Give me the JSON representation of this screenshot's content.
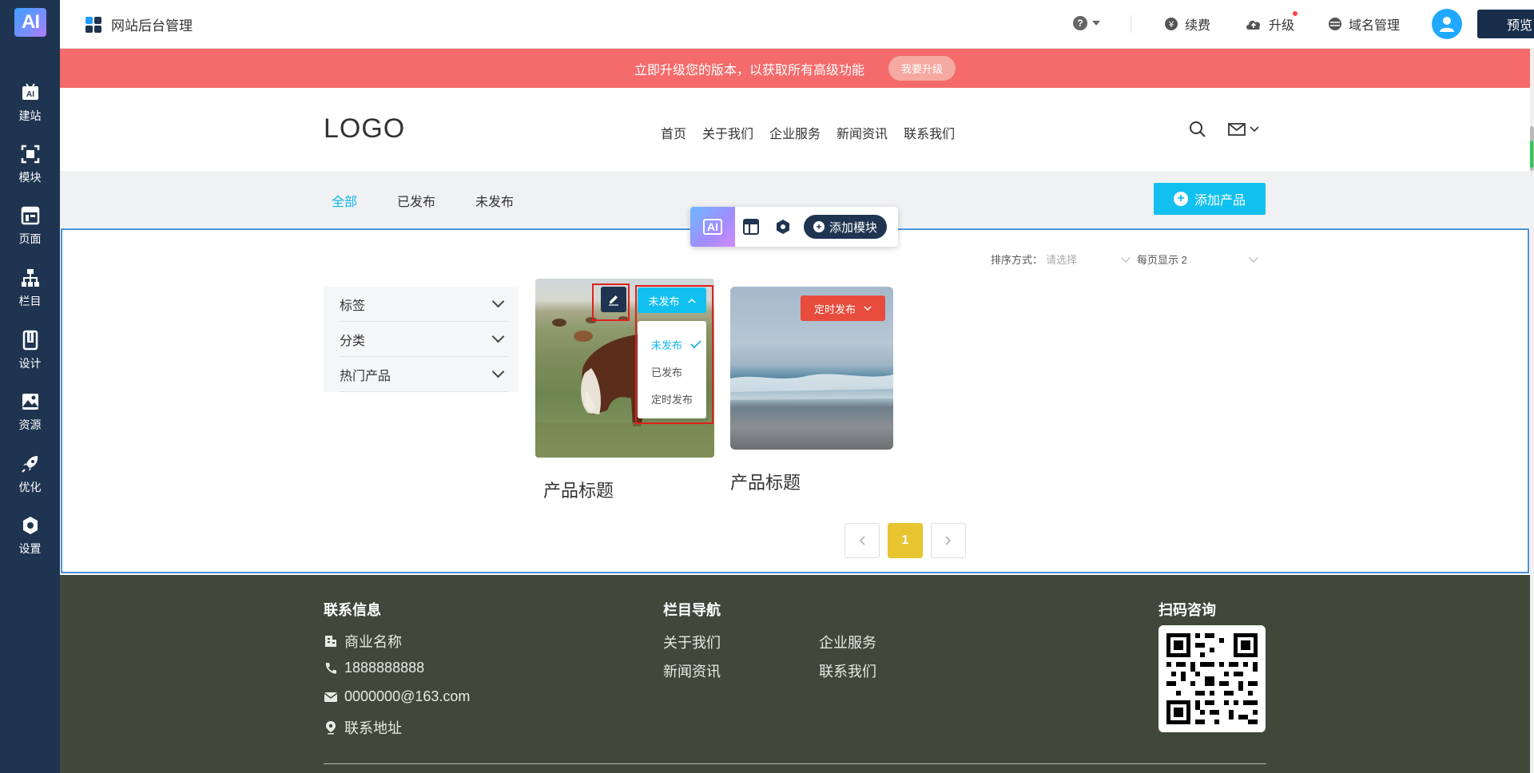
{
  "sidebar": {
    "logo": "AI",
    "items": [
      {
        "label": "建站"
      },
      {
        "label": "模块"
      },
      {
        "label": "页面"
      },
      {
        "label": "栏目"
      },
      {
        "label": "设计"
      },
      {
        "label": "资源"
      },
      {
        "label": "优化"
      },
      {
        "label": "设置"
      }
    ]
  },
  "topbar": {
    "title": "网站后台管理",
    "help": "?",
    "renew": "续费",
    "upgrade": "升级",
    "domain": "域名管理",
    "preview": "预览"
  },
  "banner": {
    "text": "立即升级您的版本，以获取所有高级功能",
    "button": "我要升级"
  },
  "site": {
    "logo": "LOGO",
    "nav": [
      "首页",
      "关于我们",
      "企业服务",
      "新闻资讯",
      "联系我们"
    ]
  },
  "tabs": {
    "all": "全部",
    "published": "已发布",
    "unpublished": "未发布",
    "add_product": "添加产品"
  },
  "toolbar": {
    "ai": "AI",
    "add_module": "添加模块"
  },
  "sort": {
    "label": "排序方式：",
    "placeholder": "请选择",
    "per_page": "每页显示 2"
  },
  "filters": [
    "标签",
    "分类",
    "热门产品"
  ],
  "products": [
    {
      "title": "产品标题",
      "status": "未发布"
    },
    {
      "title": "产品标题",
      "status": "定时发布"
    }
  ],
  "status_menu": {
    "options": [
      "未发布",
      "已发布",
      "定时发布"
    ],
    "selected": "未发布"
  },
  "pagination": {
    "current": "1"
  },
  "footer": {
    "contact_heading": "联系信息",
    "company": "商业名称",
    "phone": "1888888888",
    "email": "0000000@163.com",
    "address": "联系地址",
    "nav_heading": "栏目导航",
    "nav_links": [
      "关于我们",
      "企业服务",
      "新闻资讯",
      "联系我们"
    ],
    "qr_heading": "扫码咨询"
  },
  "colors": {
    "sidebar": "#1f3450",
    "banner": "#f56b6b",
    "accent": "#12c0ef",
    "footer": "#3f483b",
    "pager_active": "#e8c431",
    "timed_status": "#e84c3d"
  }
}
